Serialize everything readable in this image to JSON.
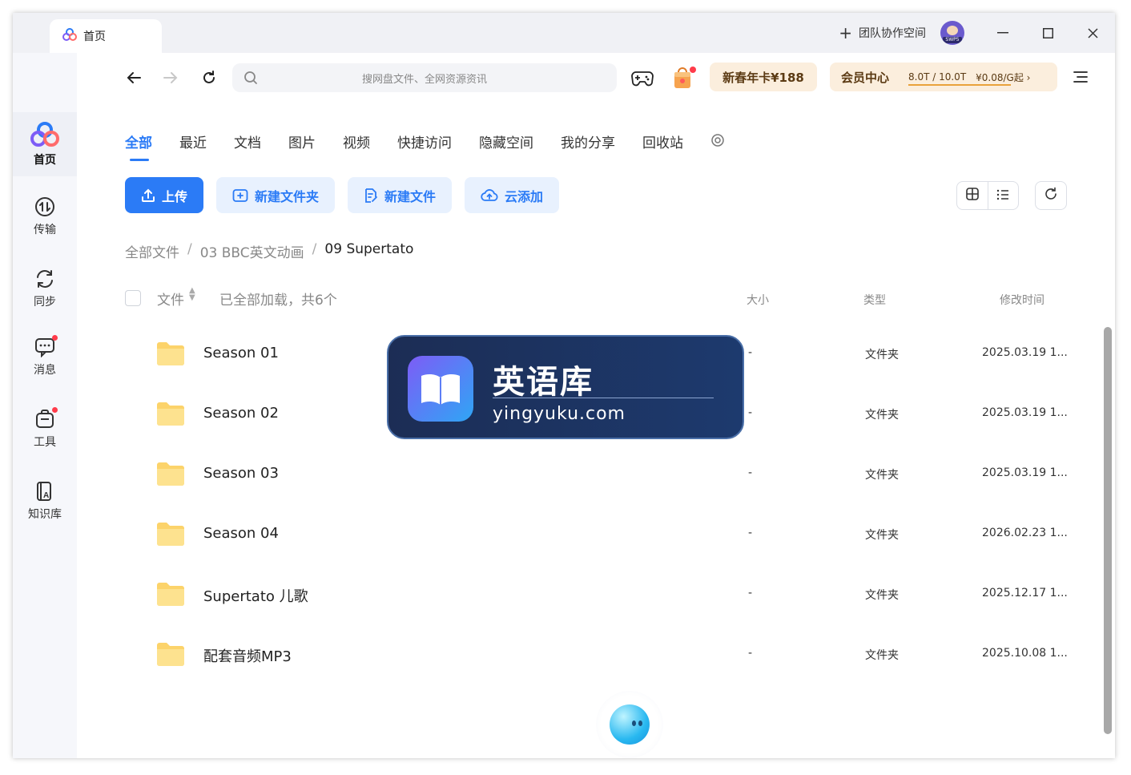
{
  "titlebar": {
    "tab_label": "首页",
    "team_space_label": "团队协作空间",
    "avatar_badge": "SWP5"
  },
  "sidebar": {
    "items": [
      {
        "label": "首页",
        "icon": "baidu-netdisk-logo-icon",
        "active": true
      },
      {
        "label": "传输",
        "icon": "transfer-icon"
      },
      {
        "label": "同步",
        "icon": "sync-icon"
      },
      {
        "label": "消息",
        "icon": "message-icon",
        "dot": true
      },
      {
        "label": "工具",
        "icon": "tools-icon",
        "dot": true
      },
      {
        "label": "知识库",
        "icon": "knowledge-base-icon"
      }
    ]
  },
  "toolbar": {
    "search_placeholder": "搜网盘文件、全网资源资讯",
    "promo_annual": "新春年卡¥188",
    "member_center": "会员中心",
    "quota": "8.0T / 10.0T",
    "price": "¥0.08/G起 ›"
  },
  "categories": [
    "全部",
    "最近",
    "文档",
    "图片",
    "视频",
    "快捷访问",
    "隐藏空间",
    "我的分享",
    "回收站"
  ],
  "actions": {
    "upload": "上传",
    "new_folder": "新建文件夹",
    "new_file": "新建文件",
    "cloud_add": "云添加"
  },
  "breadcrumb": {
    "root": "全部文件",
    "parent": "03 BBC英文动画",
    "current": "09 Supertato",
    "sep": "/"
  },
  "table": {
    "col_name": "文件",
    "status": "已全部加载，共6个",
    "col_size": "大小",
    "col_type": "类型",
    "col_time": "修改时间",
    "rows": [
      {
        "name": "Season 01",
        "size": "-",
        "type": "文件夹",
        "time": "2025.03.19 1..."
      },
      {
        "name": "Season 02",
        "size": "-",
        "type": "文件夹",
        "time": "2025.03.19 1..."
      },
      {
        "name": "Season 03",
        "size": "-",
        "type": "文件夹",
        "time": "2025.03.19 1..."
      },
      {
        "name": "Season 04",
        "size": "-",
        "type": "文件夹",
        "time": "2026.02.23 1..."
      },
      {
        "name": "Supertato 儿歌",
        "size": "-",
        "type": "文件夹",
        "time": "2025.12.17 1..."
      },
      {
        "name": "配套音频MP3",
        "size": "-",
        "type": "文件夹",
        "time": "2025.10.08 1..."
      }
    ]
  },
  "watermark": {
    "title": "英语库",
    "url": "yingyuku.com"
  },
  "colors": {
    "accent": "#2b7bf6",
    "folder": "#fcd36a",
    "promo_bg": "#fbeedd",
    "watermark_bg": "#1d3a6e"
  }
}
